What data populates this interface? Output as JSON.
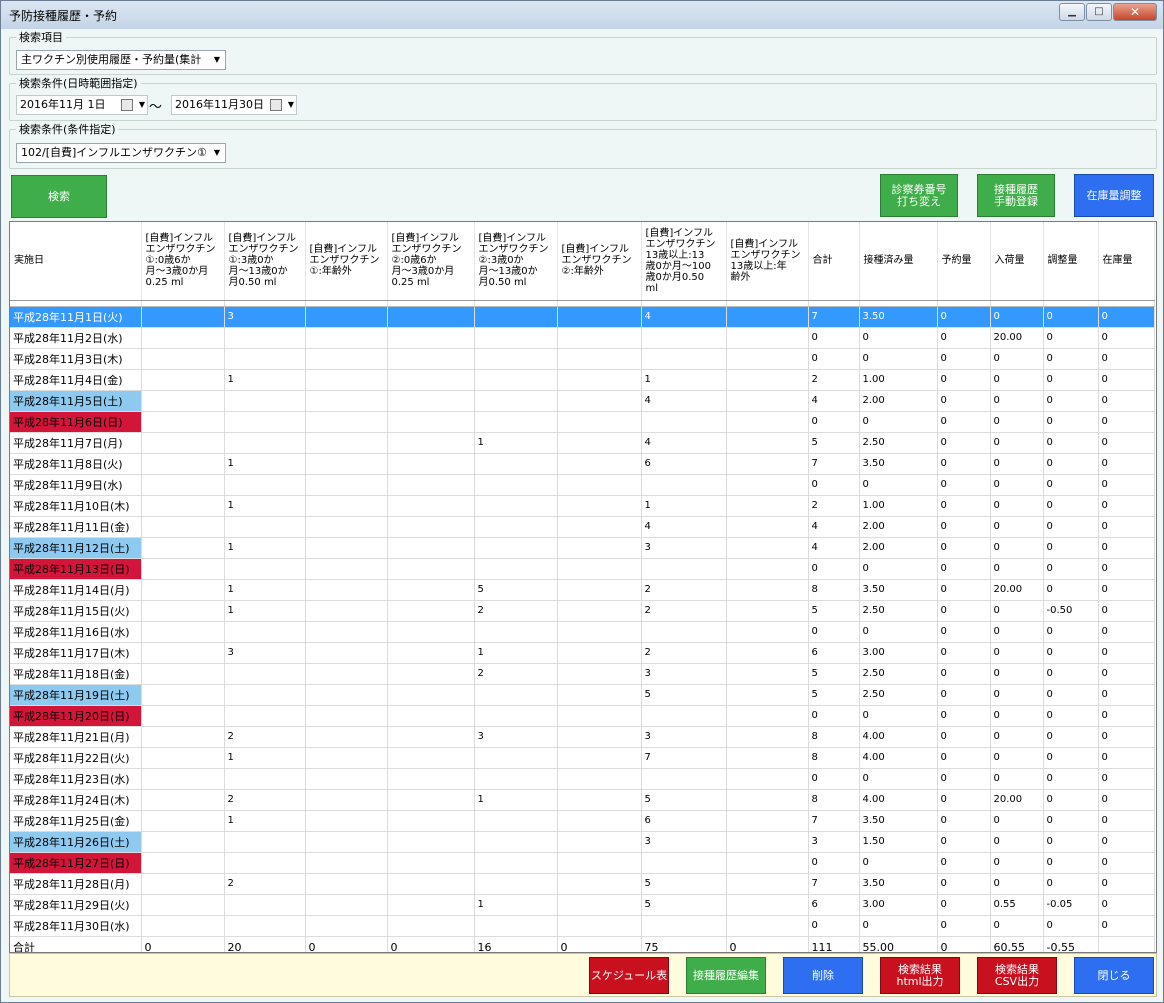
{
  "window": {
    "title": "予防接種履歴・予約",
    "min_icon": "minimize-icon",
    "max_icon": "maximize-icon",
    "close_icon": "close-icon"
  },
  "search_item": {
    "label": "検索項目",
    "value": "主ワクチン別使用履歴・予約量(集計"
  },
  "date_range": {
    "label": "検索条件(日時範囲指定)",
    "from": "2016年11月 1日",
    "tilde": "～",
    "to": "2016年11月30日"
  },
  "condition": {
    "label": "検索条件(条件指定)",
    "value": "102/[自費]インフルエンザワクチン①"
  },
  "buttons": {
    "search": "検索",
    "ticket": "診察券番号\n打ち変え",
    "manual": "接種履歴\n手動登録",
    "stock": "在庫量調整",
    "schedule": "スケジュール表",
    "edit": "接種履歴編集",
    "delete": "削除",
    "html": "検索結果\nhtml出力",
    "csv": "検索結果\nCSV出力",
    "close": "閉じる"
  },
  "colors": {
    "saturday": "#8ec9f0",
    "sunday": "#d4153a",
    "selected": "#3399ff",
    "green": "#3fae4a",
    "blue": "#2e6ff2",
    "red": "#c8101f",
    "footer": "#fffbdc"
  },
  "table": {
    "columns": [
      "実施日",
      "[自費]インフル\nエンザワクチン\n①:0歳6か\n月～3歳0か月\n0.25 ml",
      "[自費]インフル\nエンザワクチン\n①:3歳0か\n月～13歳0か\n月0.50 ml",
      "[自費]インフル\nエンザワクチン\n①:年齢外",
      "[自費]インフル\nエンザワクチン\n②:0歳6か\n月～3歳0か月\n0.25 ml",
      "[自費]インフル\nエンザワクチン\n②:3歳0か\n月～13歳0か\n月0.50 ml",
      "[自費]インフル\nエンザワクチン\n②:年齢外",
      "[自費]インフル\nエンザワクチン\n13歳以上:13\n歳0か月～100\n歳0か月0.50\nml",
      "[自費]インフル\nエンザワクチン\n13歳以上:年\n齢外",
      "合計",
      "接種済み量",
      "予約量",
      "入荷量",
      "調整量",
      "在庫量"
    ],
    "rows": [
      {
        "day": "weekday",
        "cells": [
          "平成28年11月1日(火)",
          "",
          "3",
          "",
          "",
          "",
          "",
          "4",
          "",
          "7",
          "3.50",
          "0",
          "0",
          "0",
          "0"
        ]
      },
      {
        "day": "weekday",
        "cells": [
          "平成28年11月2日(水)",
          "",
          "",
          "",
          "",
          "",
          "",
          "",
          "",
          "0",
          "0",
          "0",
          "20.00",
          "0",
          "0"
        ]
      },
      {
        "day": "weekday",
        "cells": [
          "平成28年11月3日(木)",
          "",
          "",
          "",
          "",
          "",
          "",
          "",
          "",
          "0",
          "0",
          "0",
          "0",
          "0",
          "0"
        ]
      },
      {
        "day": "weekday",
        "cells": [
          "平成28年11月4日(金)",
          "",
          "1",
          "",
          "",
          "",
          "",
          "1",
          "",
          "2",
          "1.00",
          "0",
          "0",
          "0",
          "0"
        ]
      },
      {
        "day": "sat",
        "cells": [
          "平成28年11月5日(土)",
          "",
          "",
          "",
          "",
          "",
          "",
          "4",
          "",
          "4",
          "2.00",
          "0",
          "0",
          "0",
          "0"
        ]
      },
      {
        "day": "sun",
        "cells": [
          "平成28年11月6日(日)",
          "",
          "",
          "",
          "",
          "",
          "",
          "",
          "",
          "0",
          "0",
          "0",
          "0",
          "0",
          "0"
        ]
      },
      {
        "day": "weekday",
        "cells": [
          "平成28年11月7日(月)",
          "",
          "",
          "",
          "",
          "1",
          "",
          "4",
          "",
          "5",
          "2.50",
          "0",
          "0",
          "0",
          "0"
        ]
      },
      {
        "day": "weekday",
        "cells": [
          "平成28年11月8日(火)",
          "",
          "1",
          "",
          "",
          "",
          "",
          "6",
          "",
          "7",
          "3.50",
          "0",
          "0",
          "0",
          "0"
        ]
      },
      {
        "day": "weekday",
        "cells": [
          "平成28年11月9日(水)",
          "",
          "",
          "",
          "",
          "",
          "",
          "",
          "",
          "0",
          "0",
          "0",
          "0",
          "0",
          "0"
        ]
      },
      {
        "day": "weekday",
        "cells": [
          "平成28年11月10日(木)",
          "",
          "1",
          "",
          "",
          "",
          "",
          "1",
          "",
          "2",
          "1.00",
          "0",
          "0",
          "0",
          "0"
        ]
      },
      {
        "day": "weekday",
        "cells": [
          "平成28年11月11日(金)",
          "",
          "",
          "",
          "",
          "",
          "",
          "4",
          "",
          "4",
          "2.00",
          "0",
          "0",
          "0",
          "0"
        ]
      },
      {
        "day": "sat",
        "cells": [
          "平成28年11月12日(土)",
          "",
          "1",
          "",
          "",
          "",
          "",
          "3",
          "",
          "4",
          "2.00",
          "0",
          "0",
          "0",
          "0"
        ]
      },
      {
        "day": "sun",
        "cells": [
          "平成28年11月13日(日)",
          "",
          "",
          "",
          "",
          "",
          "",
          "",
          "",
          "0",
          "0",
          "0",
          "0",
          "0",
          "0"
        ]
      },
      {
        "day": "weekday",
        "cells": [
          "平成28年11月14日(月)",
          "",
          "1",
          "",
          "",
          "5",
          "",
          "2",
          "",
          "8",
          "3.50",
          "0",
          "20.00",
          "0",
          "0"
        ]
      },
      {
        "day": "weekday",
        "cells": [
          "平成28年11月15日(火)",
          "",
          "1",
          "",
          "",
          "2",
          "",
          "2",
          "",
          "5",
          "2.50",
          "0",
          "0",
          "-0.50",
          "0"
        ]
      },
      {
        "day": "weekday",
        "cells": [
          "平成28年11月16日(水)",
          "",
          "",
          "",
          "",
          "",
          "",
          "",
          "",
          "0",
          "0",
          "0",
          "0",
          "0",
          "0"
        ]
      },
      {
        "day": "weekday",
        "cells": [
          "平成28年11月17日(木)",
          "",
          "3",
          "",
          "",
          "1",
          "",
          "2",
          "",
          "6",
          "3.00",
          "0",
          "0",
          "0",
          "0"
        ]
      },
      {
        "day": "weekday",
        "cells": [
          "平成28年11月18日(金)",
          "",
          "",
          "",
          "",
          "2",
          "",
          "3",
          "",
          "5",
          "2.50",
          "0",
          "0",
          "0",
          "0"
        ]
      },
      {
        "day": "sat",
        "cells": [
          "平成28年11月19日(土)",
          "",
          "",
          "",
          "",
          "",
          "",
          "5",
          "",
          "5",
          "2.50",
          "0",
          "0",
          "0",
          "0"
        ]
      },
      {
        "day": "sun",
        "cells": [
          "平成28年11月20日(日)",
          "",
          "",
          "",
          "",
          "",
          "",
          "",
          "",
          "0",
          "0",
          "0",
          "0",
          "0",
          "0"
        ]
      },
      {
        "day": "weekday",
        "cells": [
          "平成28年11月21日(月)",
          "",
          "2",
          "",
          "",
          "3",
          "",
          "3",
          "",
          "8",
          "4.00",
          "0",
          "0",
          "0",
          "0"
        ]
      },
      {
        "day": "weekday",
        "cells": [
          "平成28年11月22日(火)",
          "",
          "1",
          "",
          "",
          "",
          "",
          "7",
          "",
          "8",
          "4.00",
          "0",
          "0",
          "0",
          "0"
        ]
      },
      {
        "day": "weekday",
        "cells": [
          "平成28年11月23日(水)",
          "",
          "",
          "",
          "",
          "",
          "",
          "",
          "",
          "0",
          "0",
          "0",
          "0",
          "0",
          "0"
        ]
      },
      {
        "day": "weekday",
        "cells": [
          "平成28年11月24日(木)",
          "",
          "2",
          "",
          "",
          "1",
          "",
          "5",
          "",
          "8",
          "4.00",
          "0",
          "20.00",
          "0",
          "0"
        ]
      },
      {
        "day": "weekday",
        "cells": [
          "平成28年11月25日(金)",
          "",
          "1",
          "",
          "",
          "",
          "",
          "6",
          "",
          "7",
          "3.50",
          "0",
          "0",
          "0",
          "0"
        ]
      },
      {
        "day": "sat",
        "cells": [
          "平成28年11月26日(土)",
          "",
          "",
          "",
          "",
          "",
          "",
          "3",
          "",
          "3",
          "1.50",
          "0",
          "0",
          "0",
          "0"
        ]
      },
      {
        "day": "sun",
        "cells": [
          "平成28年11月27日(日)",
          "",
          "",
          "",
          "",
          "",
          "",
          "",
          "",
          "0",
          "0",
          "0",
          "0",
          "0",
          "0"
        ]
      },
      {
        "day": "weekday",
        "cells": [
          "平成28年11月28日(月)",
          "",
          "2",
          "",
          "",
          "",
          "",
          "5",
          "",
          "7",
          "3.50",
          "0",
          "0",
          "0",
          "0"
        ]
      },
      {
        "day": "weekday",
        "cells": [
          "平成28年11月29日(火)",
          "",
          "",
          "",
          "",
          "1",
          "",
          "5",
          "",
          "6",
          "3.00",
          "0",
          "0.55",
          "-0.05",
          "0"
        ]
      },
      {
        "day": "weekday",
        "cells": [
          "平成28年11月30日(水)",
          "",
          "",
          "",
          "",
          "",
          "",
          "",
          "",
          "0",
          "0",
          "0",
          "0",
          "0",
          "0"
        ]
      }
    ],
    "total": [
      "合計",
      "0",
      "20",
      "0",
      "0",
      "16",
      "0",
      "75",
      "0",
      "111",
      "55.00",
      "0",
      "60.55",
      "-0.55",
      ""
    ]
  }
}
